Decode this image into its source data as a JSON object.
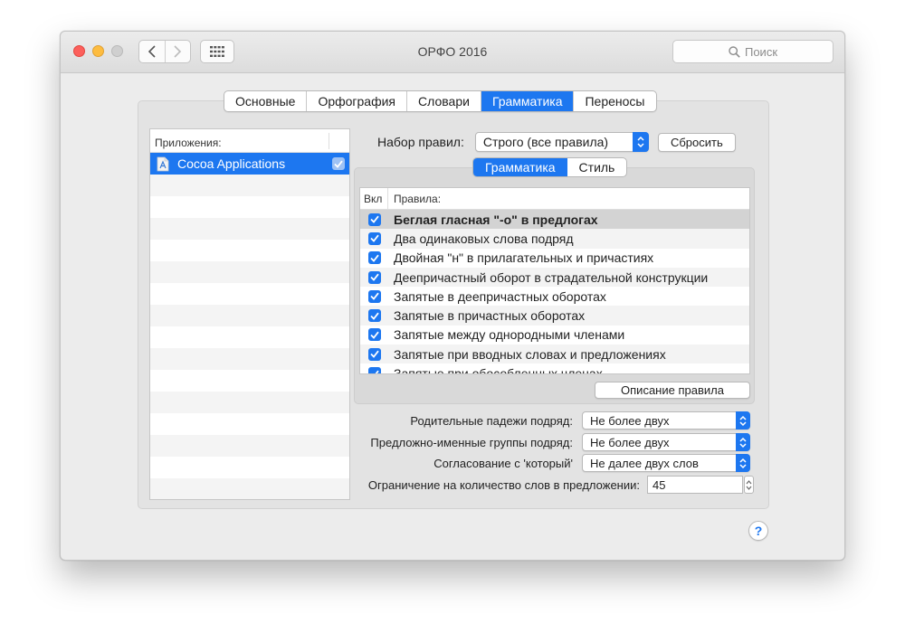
{
  "window": {
    "title": "ОРФО 2016"
  },
  "toolbar": {
    "back_icon": "chevron-left-icon",
    "forward_icon": "chevron-right-icon",
    "grid_icon": "grid-icon"
  },
  "search": {
    "placeholder": "Поиск"
  },
  "tabs": [
    {
      "label": "Основные",
      "active": false
    },
    {
      "label": "Орфография",
      "active": false
    },
    {
      "label": "Словари",
      "active": false
    },
    {
      "label": "Грамматика",
      "active": true
    },
    {
      "label": "Переносы",
      "active": false
    }
  ],
  "apps": {
    "header": "Приложения:",
    "items": [
      {
        "label": "Cocoa Applications",
        "checked": true,
        "selected": true
      }
    ]
  },
  "ruleset": {
    "label": "Набор правил:",
    "value": "Строго (все правила)",
    "reset_label": "Сбросить"
  },
  "subtabs": [
    {
      "label": "Грамматика",
      "active": true
    },
    {
      "label": "Стиль",
      "active": false
    }
  ],
  "rules_table": {
    "col_enabled": "Вкл",
    "col_rules": "Правила:",
    "rows": [
      {
        "label": "Беглая гласная \"-о\" в предлогах",
        "checked": true
      },
      {
        "label": "Два одинаковых слова подряд",
        "checked": true
      },
      {
        "label": "Двойная \"н\" в прилагательных и причастиях",
        "checked": true
      },
      {
        "label": "Деепричастный оборот в страдательной конструкции",
        "checked": true
      },
      {
        "label": "Запятые в деепричастных оборотах",
        "checked": true
      },
      {
        "label": "Запятые в причастных оборотах",
        "checked": true
      },
      {
        "label": "Запятые между однородными членами",
        "checked": true
      },
      {
        "label": "Запятые при вводных словах и предложениях",
        "checked": true
      },
      {
        "label": "Запятые при обособленных членах",
        "checked": true
      }
    ]
  },
  "rule_description_button": "Описание правила",
  "params": {
    "genitive": {
      "label": "Родительные падежи подряд:",
      "value": "Не более двух"
    },
    "prep_groups": {
      "label": "Предложно-именные группы подряд:",
      "value": "Не более двух"
    },
    "which": {
      "label": "Согласование с 'который'",
      "value": "Не далее двух слов"
    },
    "word_limit": {
      "label": "Ограничение на количество слов в предложении:",
      "value": "45"
    }
  },
  "help": {
    "label": "?"
  },
  "colors": {
    "accent": "#1d77f0"
  }
}
